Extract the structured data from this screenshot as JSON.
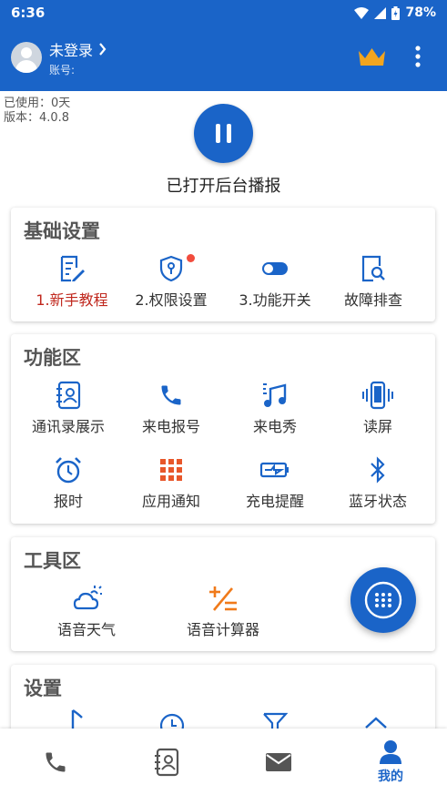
{
  "statusbar": {
    "time": "6:36",
    "battery": "78%"
  },
  "header": {
    "login_label": "未登录",
    "account_label": "账号:"
  },
  "info": {
    "used_line": "已使用：0天",
    "version_line": "版本：4.0.8"
  },
  "broadcast": {
    "status": "已打开后台播报"
  },
  "basic_settings": {
    "title": "基础设置",
    "items": [
      {
        "label": "1.新手教程",
        "icon": "tutorial-icon"
      },
      {
        "label": "2.权限设置",
        "icon": "permission-icon"
      },
      {
        "label": "3.功能开关",
        "icon": "toggle-icon"
      },
      {
        "label": "故障排查",
        "icon": "troubleshoot-icon"
      }
    ]
  },
  "features": {
    "title": "功能区",
    "items": [
      {
        "label": "通讯录展示",
        "icon": "contacts-icon"
      },
      {
        "label": "来电报号",
        "icon": "phone-icon"
      },
      {
        "label": "来电秀",
        "icon": "music-icon"
      },
      {
        "label": "读屏",
        "icon": "vibrate-phone-icon"
      },
      {
        "label": "报时",
        "icon": "alarm-clock-icon"
      },
      {
        "label": "应用通知",
        "icon": "apps-grid-icon"
      },
      {
        "label": "充电提醒",
        "icon": "battery-charging-icon"
      },
      {
        "label": "蓝牙状态",
        "icon": "bluetooth-icon"
      }
    ]
  },
  "tools": {
    "title": "工具区",
    "items": [
      {
        "label": "语音天气",
        "icon": "weather-icon"
      },
      {
        "label": "语音计算器",
        "icon": "calculator-icon"
      }
    ]
  },
  "settings": {
    "title": "设置"
  },
  "bottom_nav": {
    "items": [
      {
        "icon": "phone-icon",
        "label": ""
      },
      {
        "icon": "contacts-icon",
        "label": ""
      },
      {
        "icon": "mail-icon",
        "label": ""
      },
      {
        "icon": "person-icon",
        "label": "我的"
      }
    ]
  },
  "colors": {
    "primary": "#1a64c8",
    "accent_orange": "#f07a1a",
    "red": "#c0271d"
  }
}
